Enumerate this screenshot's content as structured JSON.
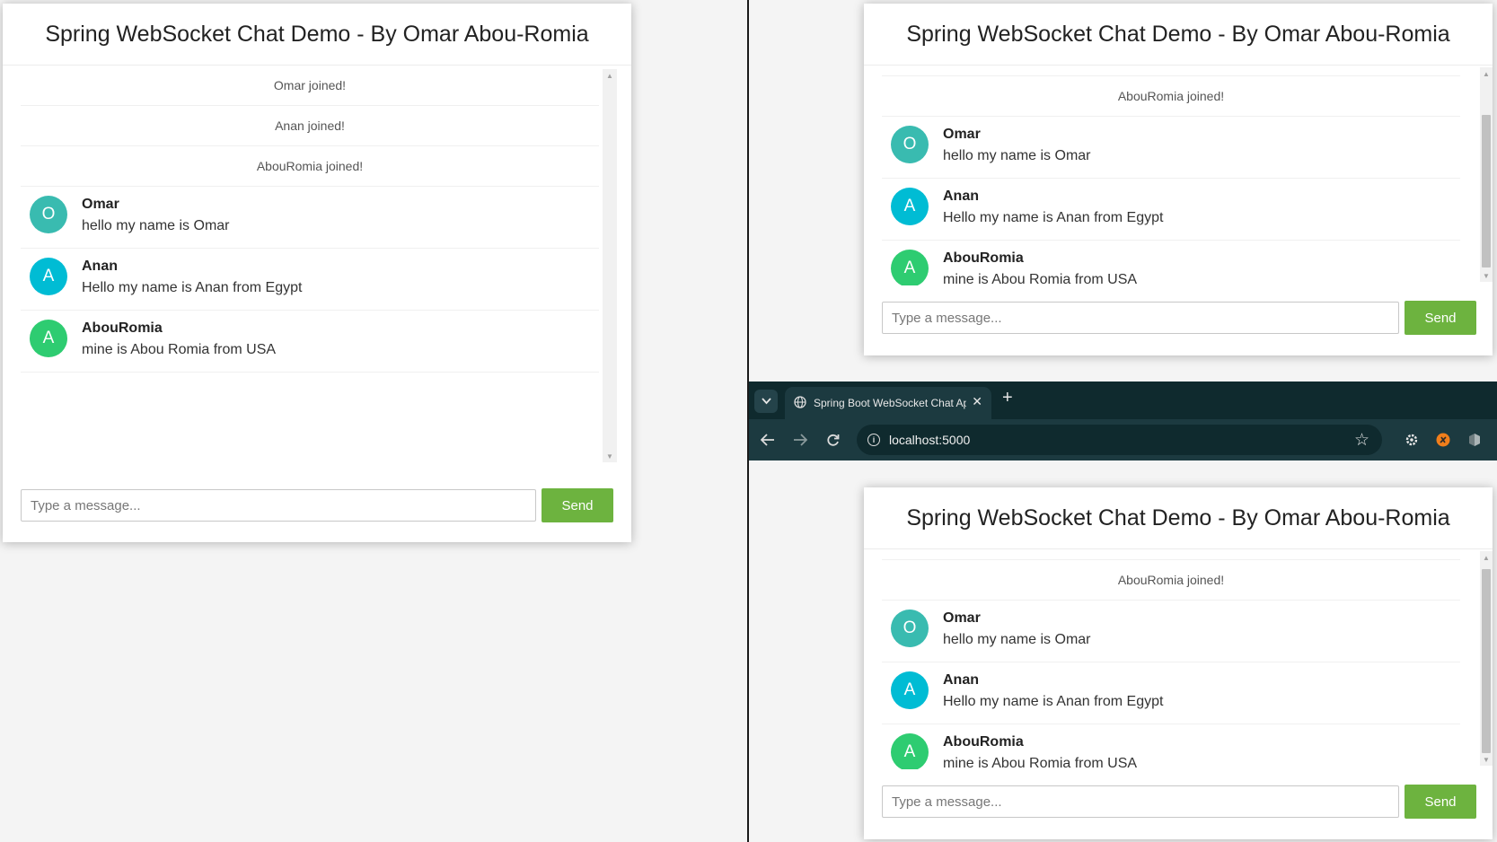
{
  "app": {
    "header_title": "Spring WebSocket Chat Demo - By Omar Abou-Romia",
    "input_placeholder": "Type a message...",
    "send_label": "Send"
  },
  "events": [
    {
      "text": "Omar joined!"
    },
    {
      "text": "Anan joined!"
    },
    {
      "text": "AbouRomia joined!"
    }
  ],
  "messages": [
    {
      "initial": "O",
      "sender": "Omar",
      "text": "hello my name is Omar",
      "avatar_color": "#39bbb0"
    },
    {
      "initial": "A",
      "sender": "Anan",
      "text": "Hello my name is Anan from Egypt",
      "avatar_color": "#00bcd4"
    },
    {
      "initial": "A",
      "sender": "AbouRomia",
      "text": "mine is Abou Romia from USA",
      "avatar_color": "#2ecc71"
    }
  ],
  "browser": {
    "tab_title": "Spring Boot WebSocket Chat App",
    "url": "localhost:5000"
  },
  "colors": {
    "send_button": "#6db33f",
    "page_background": "#f4f4f4",
    "browser_chrome": "#0f2a2e"
  },
  "icons": {
    "tab_dropdown": "chevron-down-icon",
    "tab_favicon": "globe-icon",
    "tab_close": "close-icon",
    "new_tab": "plus-icon",
    "back": "arrow-left-icon",
    "forward": "arrow-right-icon",
    "reload": "reload-icon",
    "site_info": "info-icon",
    "bookmark": "star-icon",
    "extensions": [
      "gear-extension-icon",
      "orange-extension-icon",
      "puzzle-extension-icon"
    ]
  }
}
